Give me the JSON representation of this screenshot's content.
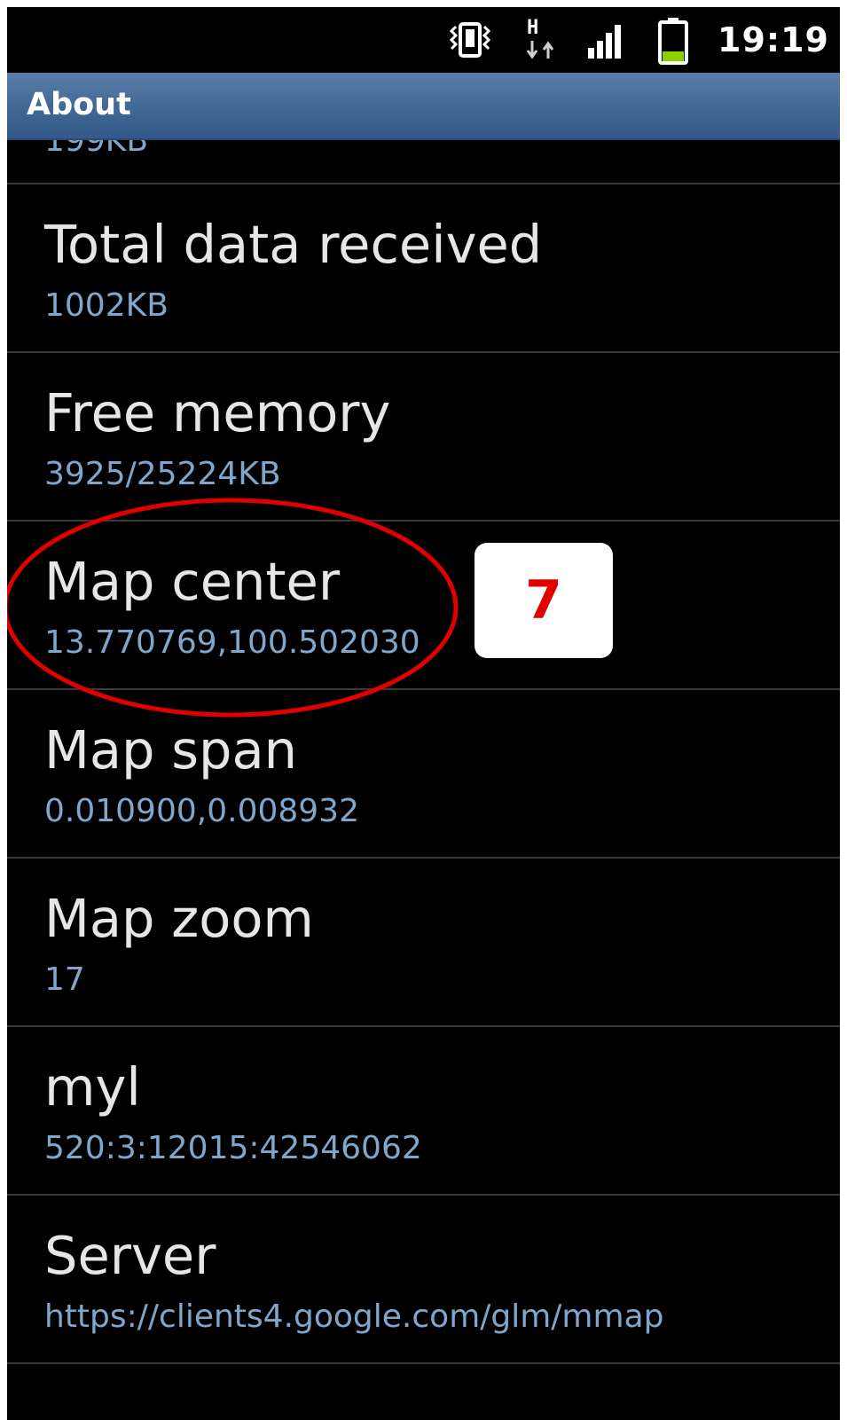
{
  "status_bar": {
    "icons": [
      "vibrate-icon",
      "hspa-data-icon",
      "signal-strength-icon",
      "battery-icon"
    ],
    "hspa_letter": "H",
    "time": "19:19"
  },
  "title_bar": {
    "title": "About"
  },
  "list": {
    "partial_value": "199KB",
    "items": [
      {
        "label": "Total data received",
        "value": "1002KB"
      },
      {
        "label": "Free memory",
        "value": "3925/25224KB"
      },
      {
        "label": "Map center",
        "value": "13.770769,100.502030"
      },
      {
        "label": "Map span",
        "value": "0.010900,0.008932"
      },
      {
        "label": "Map zoom",
        "value": "17"
      },
      {
        "label": "myl",
        "value": "520:3:12015:42546062"
      },
      {
        "label": "Server",
        "value": "https://clients4.google.com/glm/mmap"
      }
    ]
  },
  "annotation": {
    "step_number": "7",
    "highlight_color": "#e00000"
  },
  "colors": {
    "title_bar": "#3e6593",
    "label_text": "#e6e6e6",
    "value_text": "#7fa7cc",
    "battery": "#8ed000"
  }
}
